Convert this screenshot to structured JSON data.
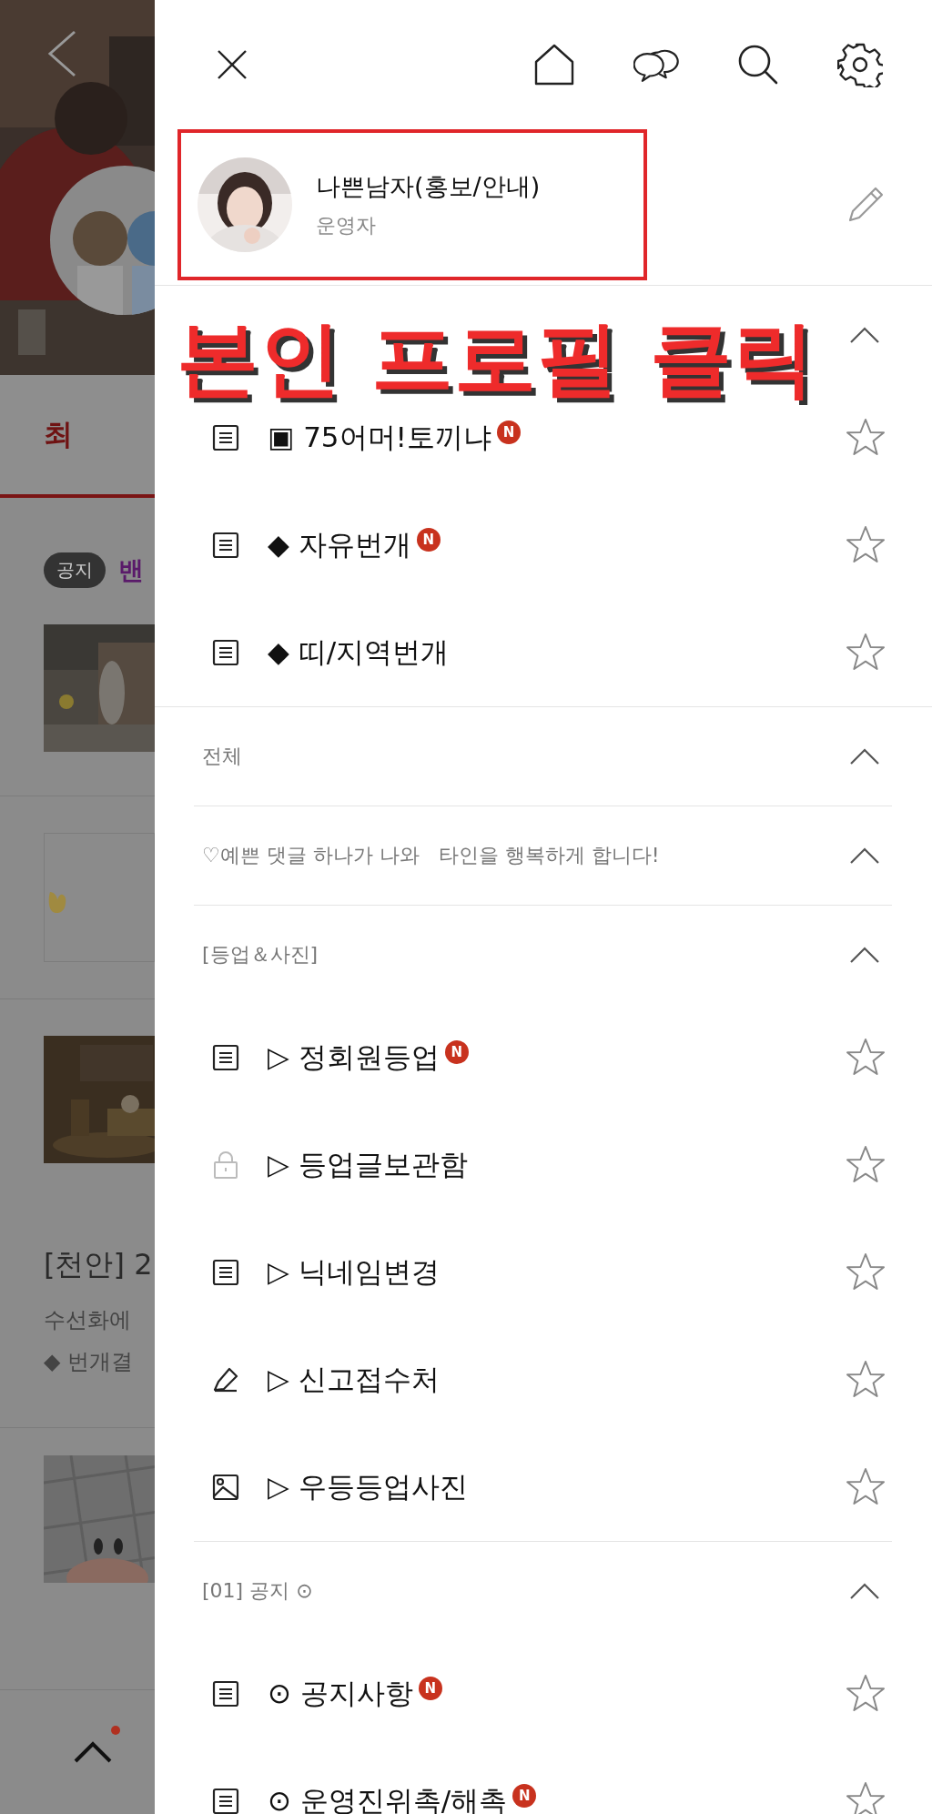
{
  "background": {
    "tab": "최",
    "notice_badge": "공지",
    "notice_title": "밴",
    "post_title": "[천안] 2",
    "post_excerpt": "수선화에",
    "post_meta": "◆ 번개결",
    "scroll_top_new": true
  },
  "drawer": {
    "profile": {
      "name": "나쁜남자(홍보/안내)",
      "role": "운영자"
    },
    "annotation": "본인 프로필 클릭",
    "sections": [
      {
        "expanded": true,
        "items": [
          {
            "kind": "board",
            "label": "▣ 75어머!토끼냐",
            "badge": "N",
            "favorite": false
          },
          {
            "kind": "board",
            "label": "◆ 자유번개",
            "badge": "N",
            "favorite": false
          },
          {
            "kind": "board",
            "label": "◆ 띠/지역번개",
            "favorite": false
          }
        ]
      },
      {
        "title": "전체",
        "expanded": true
      },
      {
        "title": "♡예쁜 댓글 하나가 나와   타인을 행복하게 합니다!",
        "expanded": true
      },
      {
        "title": "[등업＆사진]",
        "expanded": true,
        "items": [
          {
            "kind": "board",
            "label": "▷ 정회원등업",
            "badge": "N",
            "favorite": false
          },
          {
            "kind": "locked",
            "label": "▷ 등업글보관함",
            "favorite": false
          },
          {
            "kind": "board",
            "label": "▷ 닉네임변경",
            "favorite": false
          },
          {
            "kind": "memo",
            "label": "▷ 신고접수처",
            "favorite": false
          },
          {
            "kind": "album",
            "label": "▷ 우등등업사진",
            "favorite": false
          }
        ]
      },
      {
        "title": "[01] 공지 ⊙",
        "expanded": true,
        "items": [
          {
            "kind": "board",
            "label": "⊙ 공지사항",
            "badge": "N",
            "favorite": false
          },
          {
            "kind": "board",
            "label": "⊙ 운영진위촉/해촉",
            "badge": "N",
            "favorite": false
          }
        ]
      }
    ]
  }
}
